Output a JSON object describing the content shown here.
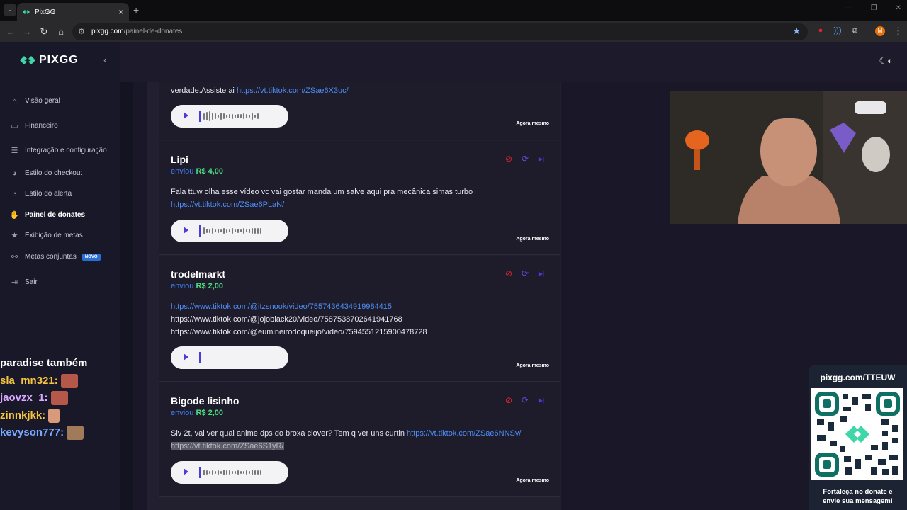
{
  "browser": {
    "tab_title": "PixGG",
    "url_host": "pixgg.com",
    "url_path": "/painel-de-donates",
    "profile_initial": "M"
  },
  "sidebar": {
    "logo": "PIXGG",
    "items": [
      {
        "label": "Visão geral",
        "icon": "home-icon"
      },
      {
        "label": "Financeiro",
        "icon": "wallet-icon"
      },
      {
        "label": "Integração e configuração",
        "icon": "settings-icon"
      },
      {
        "label": "Estilo do checkout",
        "icon": "palette-icon"
      },
      {
        "label": "Estilo do alerta",
        "icon": "bell-icon"
      },
      {
        "label": "Painel de donates",
        "icon": "donate-hand-icon"
      },
      {
        "label": "Exibição de metas",
        "icon": "star-icon"
      },
      {
        "label": "Metas conjuntas",
        "icon": "share-icon",
        "badge": "NOVO"
      },
      {
        "label": "Sair",
        "icon": "logout-icon"
      }
    ],
    "active_index": 5
  },
  "chat": {
    "lines": [
      {
        "text": "paradise também",
        "color": "#ffffff"
      },
      {
        "text": "sla_mn321:",
        "color": "#f5c542"
      },
      {
        "text": "jaovzx_1:",
        "color": "#d8a9ff"
      },
      {
        "text": "zinnkjkk:",
        "color": "#f5c542"
      },
      {
        "text": "kevyson777:",
        "color": "#7aa7ff"
      }
    ]
  },
  "donations": [
    {
      "donor": "",
      "sent_label": "",
      "amount": "",
      "message_lines": [
        [
          {
            "t": "verdade.Assiste ai ",
            "link": false
          },
          {
            "t": "https://vt.tiktok.com/ZSae6X3uc/",
            "link": true
          }
        ]
      ],
      "time": "Agora mesmo"
    },
    {
      "donor": "Lipi",
      "sent_label": "enviou",
      "amount": "R$ 4,00",
      "message_lines": [
        [
          {
            "t": "Fala ttuw olha esse vídeo vc vai gostar manda um salve aqui pra mecânica simas turbo",
            "link": false
          }
        ],
        [
          {
            "t": "https://vt.tiktok.com/ZSae6PLaN/",
            "link": true
          }
        ]
      ],
      "time": "Agora mesmo"
    },
    {
      "donor": "trodelmarkt",
      "sent_label": "enviou",
      "amount": "R$ 2,00",
      "message_lines": [
        [
          {
            "t": "https://www.tiktok.com/@itzsnook/video/7557436434919984415",
            "link": true
          }
        ],
        [
          {
            "t": "https://www.tiktok.com/@jojoblack20/video/7587538702641941768",
            "link": false
          }
        ],
        [
          {
            "t": "https://www.tiktok.com/@eumineirodoqueijo/video/7594551215900478728",
            "link": false
          }
        ]
      ],
      "time": "Agora mesmo"
    },
    {
      "donor": "Bigode lisinho",
      "sent_label": "enviou",
      "amount": "R$ 2,00",
      "message_lines": [
        [
          {
            "t": "Slv 2t, vai ver qual anime dps do broxa clover? Tem q ver uns curtin ",
            "link": false
          },
          {
            "t": "https://vt.tiktok.com/ZSae6NNSv/",
            "link": true
          }
        ],
        [
          {
            "t": "https://vt.tiktok.com/ZSae6S1yR/",
            "link": false,
            "selected": true
          }
        ]
      ],
      "time": "Agora mesmo"
    }
  ],
  "qr": {
    "title": "pixgg.com/TTEUW",
    "text_line1": "Fortaleça no donate e",
    "text_line2": "envie sua mensagem!"
  },
  "colors": {
    "accent_green": "#4ade80",
    "link_blue": "#4c8df6",
    "ban_red": "#e0242e",
    "brand_purple": "#4b3bd8"
  }
}
